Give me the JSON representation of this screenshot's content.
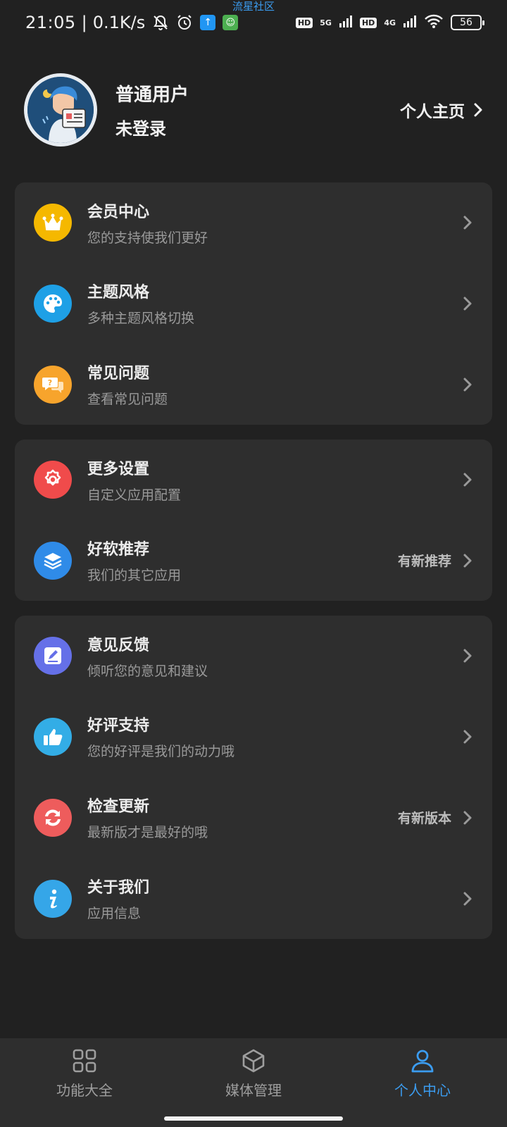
{
  "status_bar": {
    "time": "21:05",
    "separator": "|",
    "net_speed": "0.1K/s",
    "notification_label": "流星社区",
    "hd1": "HD",
    "net1": "5G",
    "hd2": "HD",
    "net2": "4G",
    "battery": "56",
    "icons": [
      "bell-off-icon",
      "alarm-icon",
      "app-upload-icon",
      "app-green-icon",
      "wifi-icon"
    ]
  },
  "profile": {
    "name": "普通用户",
    "status": "未登录",
    "home_link": "个人主页"
  },
  "groups": [
    {
      "items": [
        {
          "title": "会员中心",
          "subtitle": "您的支持使我们更好",
          "icon": "crown-icon",
          "color": "#f5b800"
        },
        {
          "title": "主题风格",
          "subtitle": "多种主题风格切换",
          "icon": "palette-icon",
          "color": "#1ea0e6"
        },
        {
          "title": "常见问题",
          "subtitle": "查看常见问题",
          "icon": "question-chat-icon",
          "color": "#f7a42c"
        }
      ]
    },
    {
      "items": [
        {
          "title": "更多设置",
          "subtitle": "自定义应用配置",
          "icon": "settings-icon",
          "color": "#f04b4b"
        },
        {
          "title": "好软推荐",
          "subtitle": "我们的其它应用",
          "icon": "layers-icon",
          "color": "#2f8be8",
          "extra": "有新推荐"
        }
      ]
    },
    {
      "items": [
        {
          "title": "意见反馈",
          "subtitle": "倾听您的意见和建议",
          "icon": "edit-icon",
          "color": "#6570e8"
        },
        {
          "title": "好评支持",
          "subtitle": "您的好评是我们的动力哦",
          "icon": "thumbs-up-icon",
          "color": "#33ade6"
        },
        {
          "title": "检查更新",
          "subtitle": "最新版才是最好的哦",
          "icon": "refresh-icon",
          "color": "#ee5c5c",
          "extra": "有新版本"
        },
        {
          "title": "关于我们",
          "subtitle": "应用信息",
          "icon": "info-icon",
          "color": "#35a6e8"
        }
      ]
    }
  ],
  "bottom_nav": {
    "items": [
      {
        "label": "功能大全",
        "icon": "grid-icon"
      },
      {
        "label": "媒体管理",
        "icon": "cube-icon"
      },
      {
        "label": "个人中心",
        "icon": "person-icon",
        "active": true
      }
    ],
    "active_color": "#3b9cf0"
  }
}
